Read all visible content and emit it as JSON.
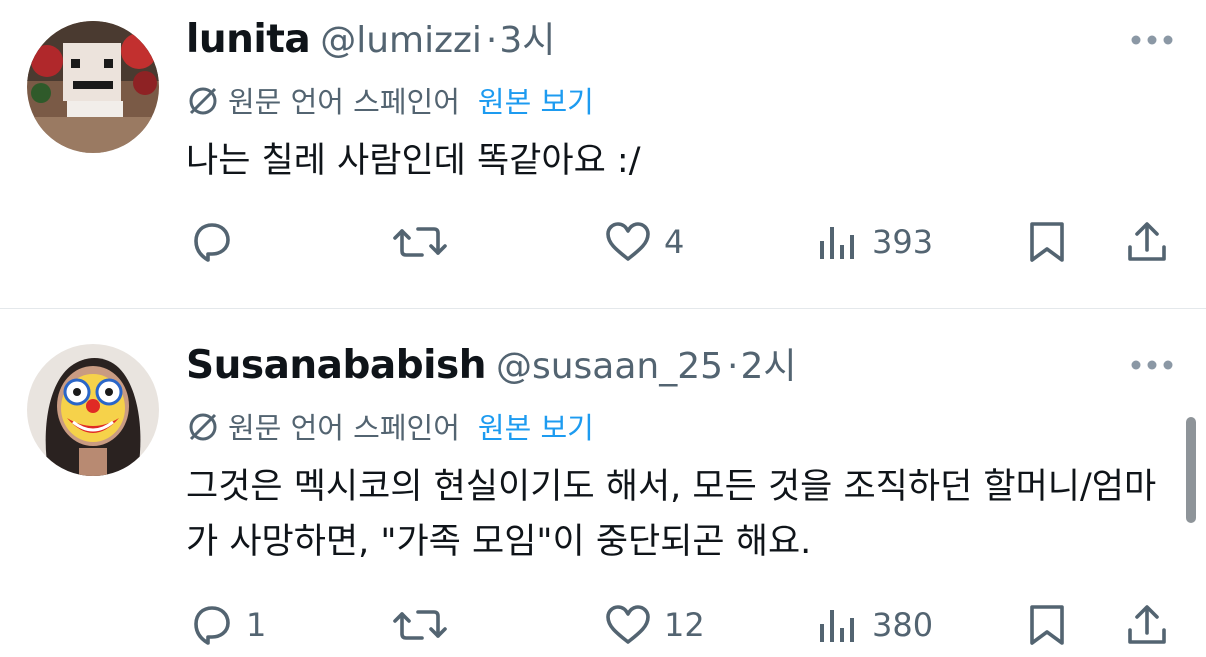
{
  "tweets": [
    {
      "display_name": "lunita",
      "handle": "@lumizzi",
      "separator": "·",
      "time": "3시",
      "translation_note": "원문 언어 스페인어",
      "show_original": "원본 보기",
      "text": "나는 칠레 사람인데 똑같아요 :/",
      "replies": "",
      "retweets": "",
      "likes": "4",
      "views": "393"
    },
    {
      "display_name": "Susanababish",
      "handle": "@susaan_25",
      "separator": "·",
      "time": "2시",
      "translation_note": "원문 언어 스페인어",
      "show_original": "원본 보기",
      "text": "그것은 멕시코의 현실이기도 해서, 모든 것을 조직하던 할머니/엄마가 사망하면, \"가족 모임\"이 중단되곤 해요.",
      "replies": "1",
      "retweets": "",
      "likes": "12",
      "views": "380"
    }
  ],
  "icons": {
    "more": "more-horizontal-icon",
    "translate": "translate-icon",
    "reply": "reply-icon",
    "retweet": "retweet-icon",
    "like": "heart-icon",
    "views": "views-icon",
    "bookmark": "bookmark-icon",
    "share": "share-icon"
  },
  "colors": {
    "text": "#0f1419",
    "secondary": "#536471",
    "link": "#1d9bf0",
    "divider": "#e4e8eb"
  }
}
